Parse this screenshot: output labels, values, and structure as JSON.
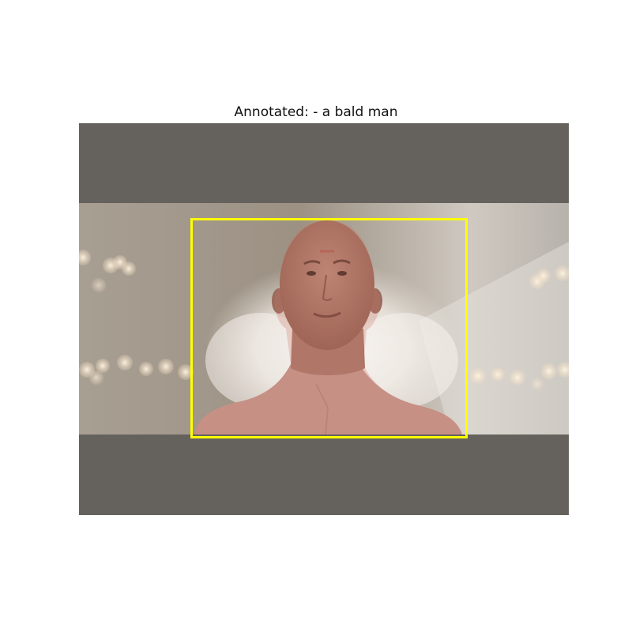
{
  "title": "Annotated: - a bald man",
  "annotation": {
    "label": "a bald man",
    "box_color": "#ffff00",
    "mask_color": "#c87864"
  },
  "colors": {
    "letterbox": "#65615d",
    "background_warm": "#a79c8f",
    "highlight": "#f2ede6"
  }
}
